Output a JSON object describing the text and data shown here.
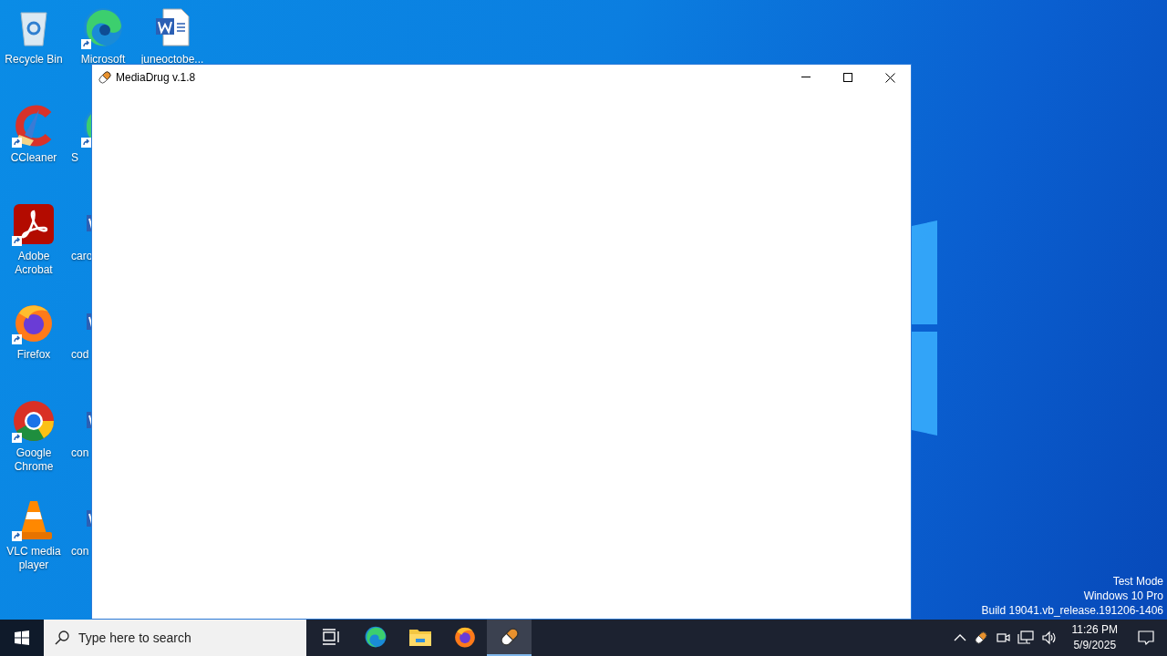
{
  "desktop": {
    "columns": [
      [
        {
          "label": "Recycle Bin",
          "kind": "recycle",
          "shortcut": false
        },
        {
          "label": "CCleaner",
          "kind": "ccleaner",
          "shortcut": true
        },
        {
          "label": "Adobe Acrobat",
          "kind": "acrobat",
          "shortcut": true
        },
        {
          "label": "Firefox",
          "kind": "firefox",
          "shortcut": true
        },
        {
          "label": "Google Chrome",
          "kind": "chrome",
          "shortcut": true
        },
        {
          "label": "VLC media player",
          "kind": "vlc",
          "shortcut": true
        }
      ],
      [
        {
          "label": "Microsoft",
          "kind": "edge",
          "shortcut": true
        },
        {
          "label": "S",
          "kind": "edge",
          "shortcut": true
        },
        {
          "label": "caro",
          "kind": "word",
          "shortcut": false
        },
        {
          "label": "cod",
          "kind": "word",
          "shortcut": false
        },
        {
          "label": "con",
          "kind": "word",
          "shortcut": false
        },
        {
          "label": "con",
          "kind": "word",
          "shortcut": false
        }
      ],
      [
        {
          "label": "juneoctobe...",
          "kind": "word",
          "shortcut": false
        }
      ]
    ],
    "system_watermark": [
      "Test Mode",
      "Windows 10 Pro",
      "Build 19041.vb_release.191206-1406"
    ]
  },
  "window": {
    "title": "MediaDrug v.1.8"
  },
  "taskbar": {
    "search": {
      "placeholder": "Type here to search"
    },
    "apps": [
      {
        "kind": "taskview",
        "selected": false
      },
      {
        "kind": "edge",
        "selected": false
      },
      {
        "kind": "explorer",
        "selected": false
      },
      {
        "kind": "firefox",
        "selected": false
      },
      {
        "kind": "mediadrug",
        "selected": true
      }
    ],
    "tray": [
      {
        "kind": "chevron"
      },
      {
        "kind": "pill"
      },
      {
        "kind": "camera"
      },
      {
        "kind": "network"
      },
      {
        "kind": "volume"
      }
    ],
    "time": "11:26 PM",
    "date": "5/9/2025"
  }
}
